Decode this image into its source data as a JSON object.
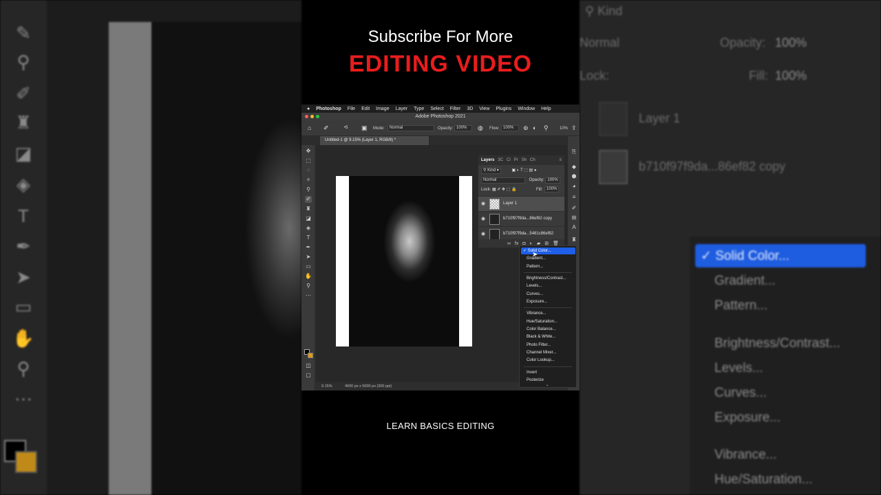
{
  "captions": {
    "top": "Subscribe For More",
    "headline": "EDITING VIDEO",
    "bottom": "LEARN BASICS EDITING"
  },
  "menubar": [
    "Photoshop",
    "File",
    "Edit",
    "Image",
    "Layer",
    "Type",
    "Select",
    "Filter",
    "3D",
    "View",
    "Plugins",
    "Window",
    "Help"
  ],
  "window": {
    "title": "Adobe Photoshop 2021"
  },
  "options": {
    "mode_label": "Mode:",
    "mode_value": "Normal",
    "opacity_label": "Opacity:",
    "opacity_value": "100%",
    "flow_label": "Flow:",
    "flow_value": "100%",
    "angle_value": "10%"
  },
  "document": {
    "tab": "Untitled-1 @ 9.15% (Layer 1, RGB/8) *",
    "zoom": "9.15%",
    "info": "4000 px x 5000 px (300 ppi)"
  },
  "layers_panel": {
    "tabs": [
      "Layers",
      "3C",
      "Cl",
      "Pr",
      "Sh",
      "Ch"
    ],
    "filter_label": "Kind",
    "blend_mode": "Normal",
    "opacity_label": "Opacity:",
    "opacity_value": "100%",
    "lock_label": "Lock:",
    "fill_label": "Fill:",
    "fill_value": "100%",
    "layers": [
      {
        "name": "Layer 1"
      },
      {
        "name": "b710f97f9da...86ef82 copy"
      },
      {
        "name": "b710f97f9da...5481c86ef82"
      }
    ]
  },
  "adjust_menu": {
    "selected": "Solid Color...",
    "groups": [
      [
        "Gradient...",
        "Pattern..."
      ],
      [
        "Brightness/Contrast...",
        "Levels...",
        "Curves...",
        "Exposure..."
      ],
      [
        "Vibrance...",
        "Hue/Saturation...",
        "Color Balance...",
        "Black & White...",
        "Photo Filter...",
        "Channel Mixer...",
        "Color Lookup..."
      ],
      [
        "Invert",
        "Posterize"
      ]
    ]
  },
  "zoom_bg": {
    "kind_label": "Kind",
    "mode": "Normal",
    "opacity_label": "Opacity:",
    "opacity_value": "100%",
    "lock_label": "Lock:",
    "fill_label": "Fill:",
    "fill_value": "100%",
    "layer1": "Layer 1",
    "layer2": "b710f97f9da...86ef82 copy",
    "menu_selected": "Solid Color...",
    "menu_items": [
      "Gradient...",
      "Pattern...",
      "Brightness/Contrast...",
      "Levels...",
      "Curves...",
      "Exposure...",
      "Vibrance...",
      "Hue/Saturation..."
    ]
  }
}
